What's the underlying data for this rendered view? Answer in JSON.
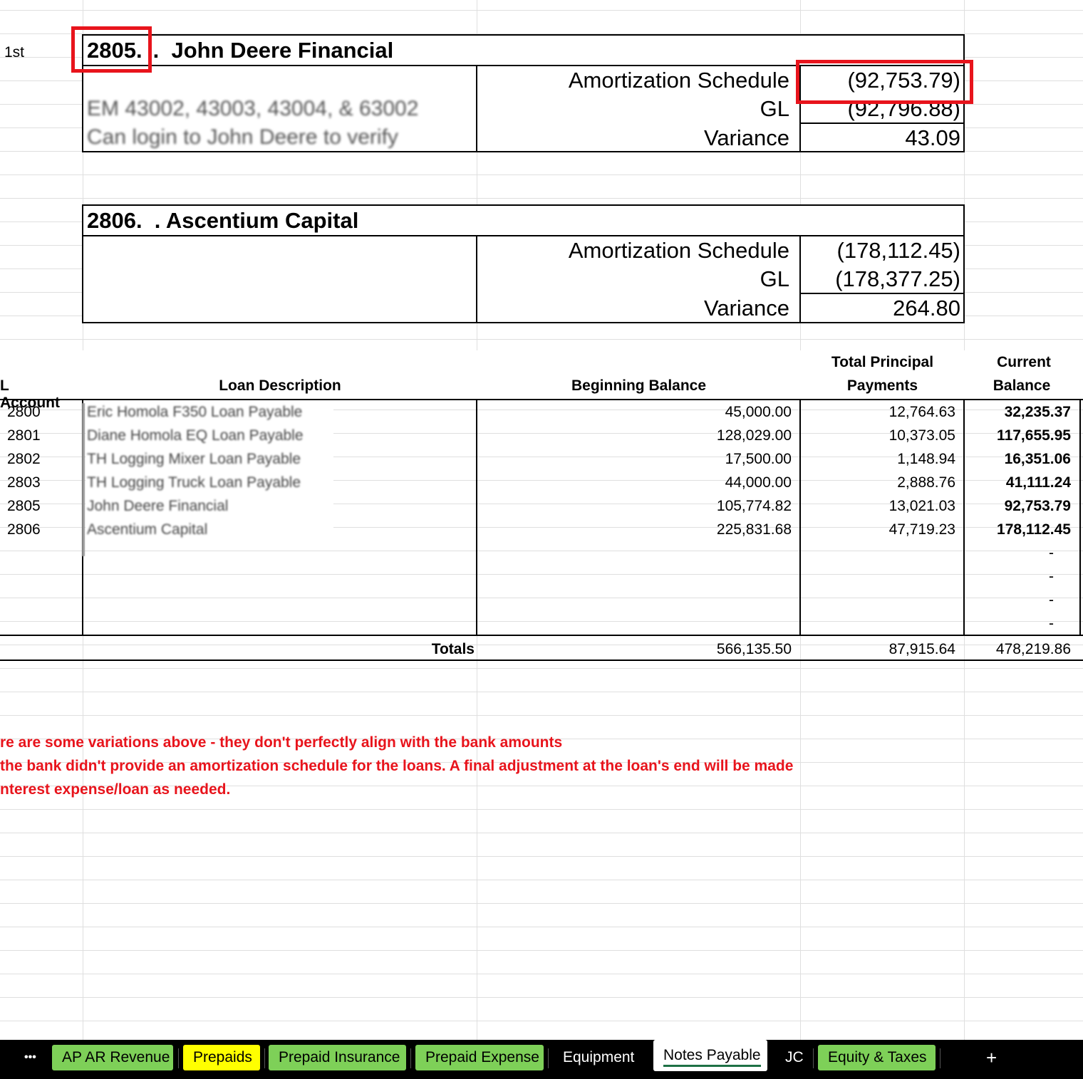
{
  "row_label": "1st",
  "section1": {
    "number": "2805.",
    "title": " .  John Deere Financial",
    "notes": [
      "EM 43002, 43003, 43004, & 63002",
      "Can login to John Deere to verify"
    ],
    "amort_label": "Amortization Schedule",
    "amort_value": "(92,753.79)",
    "gl_label": "GL",
    "gl_value": "(92,796.88)",
    "variance_label": "Variance",
    "variance_value": "43.09"
  },
  "section2": {
    "title": "2806.  . Ascentium Capital",
    "amort_label": "Amortization Schedule",
    "amort_value": "(178,112.45)",
    "gl_label": "GL",
    "gl_value": "(178,377.25)",
    "variance_label": "Variance",
    "variance_value": "264.80"
  },
  "table": {
    "headers": {
      "account": "L Account",
      "description": "Loan Description",
      "beginning": "Beginning Balance",
      "principal_1": "Total Principal",
      "principal_2": "Payments",
      "current_1": "Current",
      "current_2": "Balance"
    },
    "rows": [
      {
        "account": "2800",
        "description": "Eric Homola F350 Loan Payable",
        "beginning": "45,000.00",
        "principal": "12,764.63",
        "current": "32,235.37"
      },
      {
        "account": "2801",
        "description": "Diane Homola EQ Loan Payable",
        "beginning": "128,029.00",
        "principal": "10,373.05",
        "current": "117,655.95"
      },
      {
        "account": "2802",
        "description": "TH Logging Mixer Loan Payable",
        "beginning": "17,500.00",
        "principal": "1,148.94",
        "current": "16,351.06"
      },
      {
        "account": "2803",
        "description": "TH Logging Truck Loan Payable",
        "beginning": "44,000.00",
        "principal": "2,888.76",
        "current": "41,111.24"
      },
      {
        "account": "2805",
        "description": "John Deere Financial",
        "beginning": "105,774.82",
        "principal": "13,021.03",
        "current": "92,753.79"
      },
      {
        "account": "2806",
        "description": "Ascentium Capital",
        "beginning": "225,831.68",
        "principal": "47,719.23",
        "current": "178,112.45"
      }
    ],
    "empty_current": [
      "-",
      "-",
      "-",
      "-"
    ],
    "totals_label": "Totals",
    "totals_beginning": "566,135.50",
    "totals_principal": "87,915.64",
    "totals_current": "478,219.86"
  },
  "notes": [
    "re are some variations above - they don't perfectly align with the bank amounts",
    "the bank didn't provide an amortization schedule for the loans. A final adjustment at the loan's end will be made",
    "nterest expense/loan as needed."
  ],
  "tabs": {
    "more": "•••",
    "items": [
      {
        "label": "AP AR Revenue"
      },
      {
        "label": "Prepaids"
      },
      {
        "label": "Prepaid Insurance"
      },
      {
        "label": "Prepaid Expense"
      },
      {
        "label": "Equipment"
      },
      {
        "label": "Notes Payable"
      },
      {
        "label": "JC"
      },
      {
        "label": "Equity & Taxes"
      }
    ],
    "add": "+"
  },
  "colors": {
    "highlight_red": "#e8141c",
    "tab_green": "#7ed058",
    "tab_yellow": "#ffff00",
    "note_red": "#e8141c"
  }
}
